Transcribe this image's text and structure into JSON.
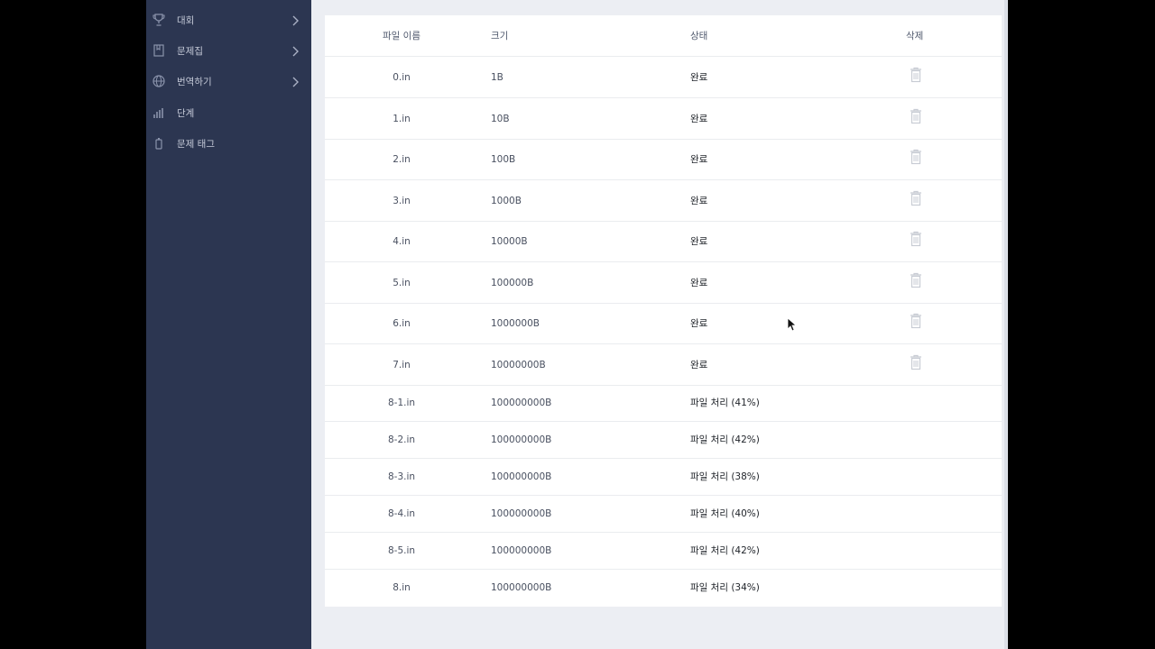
{
  "sidebar": {
    "items": [
      {
        "label": "대회",
        "icon": "trophy-icon",
        "has_chevron": true
      },
      {
        "label": "문제집",
        "icon": "book-icon",
        "has_chevron": true
      },
      {
        "label": "번역하기",
        "icon": "globe-icon",
        "has_chevron": true
      },
      {
        "label": "단계",
        "icon": "bar-chart-icon",
        "has_chevron": false
      },
      {
        "label": "문제 태그",
        "icon": "tag-icon",
        "has_chevron": false
      }
    ]
  },
  "table": {
    "headers": {
      "name": "파일 이름",
      "size": "크기",
      "status": "상태",
      "delete": "삭제"
    },
    "rows": [
      {
        "name": "0.in",
        "size": "1B",
        "status": "완료",
        "deletable": true
      },
      {
        "name": "1.in",
        "size": "10B",
        "status": "완료",
        "deletable": true
      },
      {
        "name": "2.in",
        "size": "100B",
        "status": "완료",
        "deletable": true
      },
      {
        "name": "3.in",
        "size": "1000B",
        "status": "완료",
        "deletable": true
      },
      {
        "name": "4.in",
        "size": "10000B",
        "status": "완료",
        "deletable": true
      },
      {
        "name": "5.in",
        "size": "100000B",
        "status": "완료",
        "deletable": true
      },
      {
        "name": "6.in",
        "size": "1000000B",
        "status": "완료",
        "deletable": true
      },
      {
        "name": "7.in",
        "size": "10000000B",
        "status": "완료",
        "deletable": true
      },
      {
        "name": "8-1.in",
        "size": "100000000B",
        "status": "파일 처리 (41%)",
        "deletable": false
      },
      {
        "name": "8-2.in",
        "size": "100000000B",
        "status": "파일 처리 (42%)",
        "deletable": false
      },
      {
        "name": "8-3.in",
        "size": "100000000B",
        "status": "파일 처리 (38%)",
        "deletable": false
      },
      {
        "name": "8-4.in",
        "size": "100000000B",
        "status": "파일 처리 (40%)",
        "deletable": false
      },
      {
        "name": "8-5.in",
        "size": "100000000B",
        "status": "파일 처리 (42%)",
        "deletable": false
      },
      {
        "name": "8.in",
        "size": "100000000B",
        "status": "파일 처리 (34%)",
        "deletable": false
      }
    ]
  },
  "colors": {
    "sidebar_bg": "#2c3651",
    "page_bg": "#eceef3",
    "panel_bg": "#ffffff",
    "icon_muted": "#c8ccd4"
  }
}
